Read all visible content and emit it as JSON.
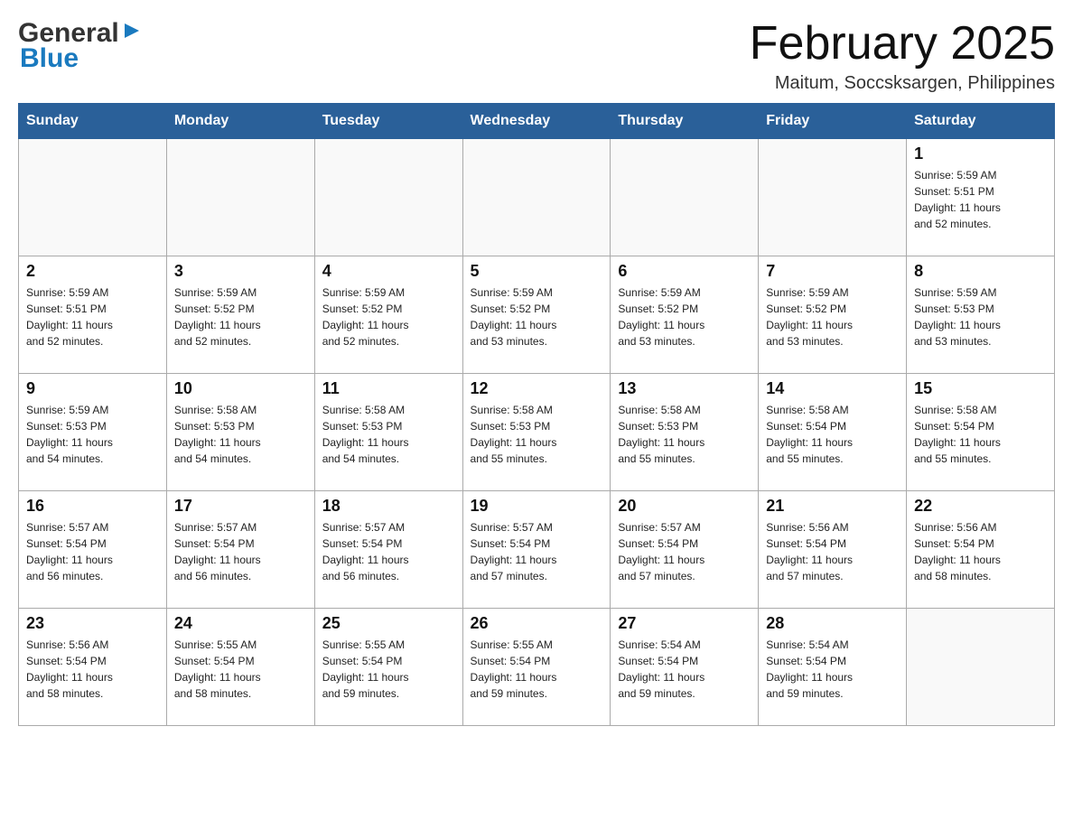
{
  "header": {
    "logo_general": "General",
    "logo_blue": "Blue",
    "calendar_title": "February 2025",
    "calendar_subtitle": "Maitum, Soccsksargen, Philippines"
  },
  "days_of_week": [
    "Sunday",
    "Monday",
    "Tuesday",
    "Wednesday",
    "Thursday",
    "Friday",
    "Saturday"
  ],
  "weeks": [
    {
      "days": [
        {
          "number": "",
          "info": ""
        },
        {
          "number": "",
          "info": ""
        },
        {
          "number": "",
          "info": ""
        },
        {
          "number": "",
          "info": ""
        },
        {
          "number": "",
          "info": ""
        },
        {
          "number": "",
          "info": ""
        },
        {
          "number": "1",
          "info": "Sunrise: 5:59 AM\nSunset: 5:51 PM\nDaylight: 11 hours\nand 52 minutes."
        }
      ]
    },
    {
      "days": [
        {
          "number": "2",
          "info": "Sunrise: 5:59 AM\nSunset: 5:51 PM\nDaylight: 11 hours\nand 52 minutes."
        },
        {
          "number": "3",
          "info": "Sunrise: 5:59 AM\nSunset: 5:52 PM\nDaylight: 11 hours\nand 52 minutes."
        },
        {
          "number": "4",
          "info": "Sunrise: 5:59 AM\nSunset: 5:52 PM\nDaylight: 11 hours\nand 52 minutes."
        },
        {
          "number": "5",
          "info": "Sunrise: 5:59 AM\nSunset: 5:52 PM\nDaylight: 11 hours\nand 53 minutes."
        },
        {
          "number": "6",
          "info": "Sunrise: 5:59 AM\nSunset: 5:52 PM\nDaylight: 11 hours\nand 53 minutes."
        },
        {
          "number": "7",
          "info": "Sunrise: 5:59 AM\nSunset: 5:52 PM\nDaylight: 11 hours\nand 53 minutes."
        },
        {
          "number": "8",
          "info": "Sunrise: 5:59 AM\nSunset: 5:53 PM\nDaylight: 11 hours\nand 53 minutes."
        }
      ]
    },
    {
      "days": [
        {
          "number": "9",
          "info": "Sunrise: 5:59 AM\nSunset: 5:53 PM\nDaylight: 11 hours\nand 54 minutes."
        },
        {
          "number": "10",
          "info": "Sunrise: 5:58 AM\nSunset: 5:53 PM\nDaylight: 11 hours\nand 54 minutes."
        },
        {
          "number": "11",
          "info": "Sunrise: 5:58 AM\nSunset: 5:53 PM\nDaylight: 11 hours\nand 54 minutes."
        },
        {
          "number": "12",
          "info": "Sunrise: 5:58 AM\nSunset: 5:53 PM\nDaylight: 11 hours\nand 55 minutes."
        },
        {
          "number": "13",
          "info": "Sunrise: 5:58 AM\nSunset: 5:53 PM\nDaylight: 11 hours\nand 55 minutes."
        },
        {
          "number": "14",
          "info": "Sunrise: 5:58 AM\nSunset: 5:54 PM\nDaylight: 11 hours\nand 55 minutes."
        },
        {
          "number": "15",
          "info": "Sunrise: 5:58 AM\nSunset: 5:54 PM\nDaylight: 11 hours\nand 55 minutes."
        }
      ]
    },
    {
      "days": [
        {
          "number": "16",
          "info": "Sunrise: 5:57 AM\nSunset: 5:54 PM\nDaylight: 11 hours\nand 56 minutes."
        },
        {
          "number": "17",
          "info": "Sunrise: 5:57 AM\nSunset: 5:54 PM\nDaylight: 11 hours\nand 56 minutes."
        },
        {
          "number": "18",
          "info": "Sunrise: 5:57 AM\nSunset: 5:54 PM\nDaylight: 11 hours\nand 56 minutes."
        },
        {
          "number": "19",
          "info": "Sunrise: 5:57 AM\nSunset: 5:54 PM\nDaylight: 11 hours\nand 57 minutes."
        },
        {
          "number": "20",
          "info": "Sunrise: 5:57 AM\nSunset: 5:54 PM\nDaylight: 11 hours\nand 57 minutes."
        },
        {
          "number": "21",
          "info": "Sunrise: 5:56 AM\nSunset: 5:54 PM\nDaylight: 11 hours\nand 57 minutes."
        },
        {
          "number": "22",
          "info": "Sunrise: 5:56 AM\nSunset: 5:54 PM\nDaylight: 11 hours\nand 58 minutes."
        }
      ]
    },
    {
      "days": [
        {
          "number": "23",
          "info": "Sunrise: 5:56 AM\nSunset: 5:54 PM\nDaylight: 11 hours\nand 58 minutes."
        },
        {
          "number": "24",
          "info": "Sunrise: 5:55 AM\nSunset: 5:54 PM\nDaylight: 11 hours\nand 58 minutes."
        },
        {
          "number": "25",
          "info": "Sunrise: 5:55 AM\nSunset: 5:54 PM\nDaylight: 11 hours\nand 59 minutes."
        },
        {
          "number": "26",
          "info": "Sunrise: 5:55 AM\nSunset: 5:54 PM\nDaylight: 11 hours\nand 59 minutes."
        },
        {
          "number": "27",
          "info": "Sunrise: 5:54 AM\nSunset: 5:54 PM\nDaylight: 11 hours\nand 59 minutes."
        },
        {
          "number": "28",
          "info": "Sunrise: 5:54 AM\nSunset: 5:54 PM\nDaylight: 11 hours\nand 59 minutes."
        },
        {
          "number": "",
          "info": ""
        }
      ]
    }
  ]
}
